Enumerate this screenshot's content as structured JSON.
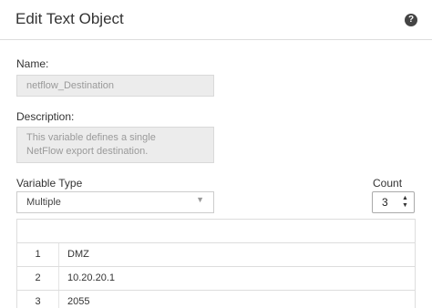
{
  "header": {
    "title": "Edit Text Object",
    "help_icon": "?"
  },
  "form": {
    "name_label": "Name:",
    "name_value": "netflow_Destination",
    "description_label": "Description:",
    "description_line1": "This variable defines a single",
    "description_line2": "NetFlow export destination.",
    "variable_type_label": "Variable Type",
    "variable_type_value": "Multiple",
    "count_label": "Count",
    "count_value": "3"
  },
  "table": {
    "rows": [
      {
        "index": "1",
        "value": "DMZ"
      },
      {
        "index": "2",
        "value": "10.20.20.1"
      },
      {
        "index": "3",
        "value": "2055"
      }
    ]
  }
}
